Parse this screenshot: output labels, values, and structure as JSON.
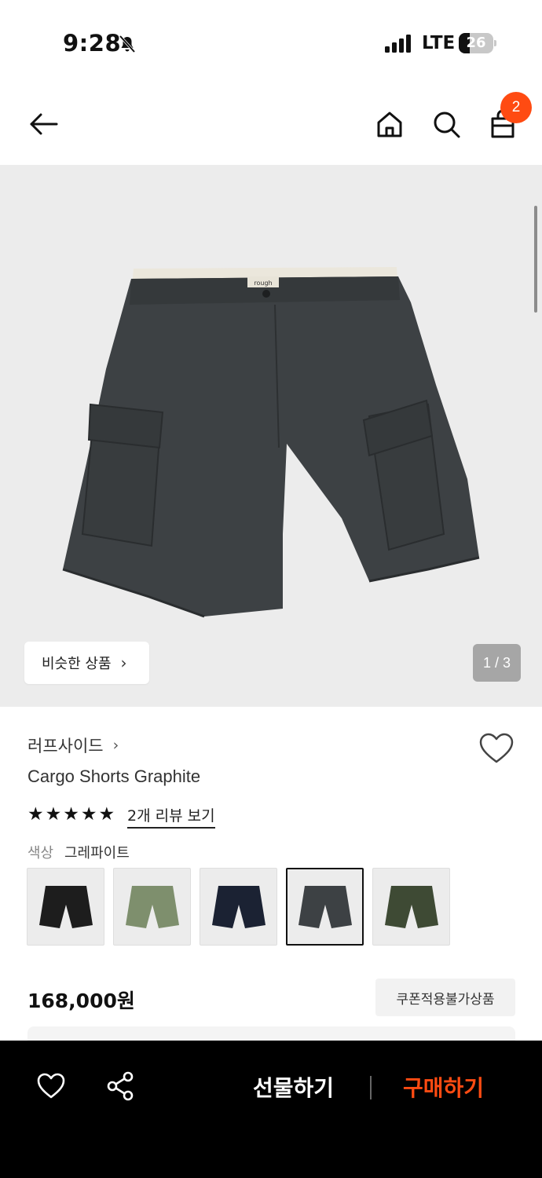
{
  "status_bar": {
    "time": "9:28",
    "network": "LTE",
    "battery": "26"
  },
  "header": {
    "cart_count": "2"
  },
  "gallery": {
    "similar_label": "비슷한 상품",
    "pager": "1 / 3",
    "tag_text": "rough"
  },
  "product": {
    "brand": "러프사이드",
    "name": "Cargo Shorts Graphite",
    "rating_stars": 5,
    "reviews_link": "2개 리뷰 보기",
    "color_label": "색상",
    "color_value": "그레파이트",
    "swatches": [
      {
        "color": "#1d1d1d"
      },
      {
        "color": "#7e8f6d"
      },
      {
        "color": "#1b2233"
      },
      {
        "color": "#3d4144",
        "selected": true
      },
      {
        "color": "#3e4a34"
      }
    ],
    "price": "168,000원",
    "coupon_label": "쿠폰적용불가상품"
  },
  "bottom_bar": {
    "gift_label": "선물하기",
    "buy_label": "구매하기"
  },
  "colors": {
    "accent": "#ff4b12",
    "shorts": "#3d4144",
    "background": "#ececec"
  }
}
